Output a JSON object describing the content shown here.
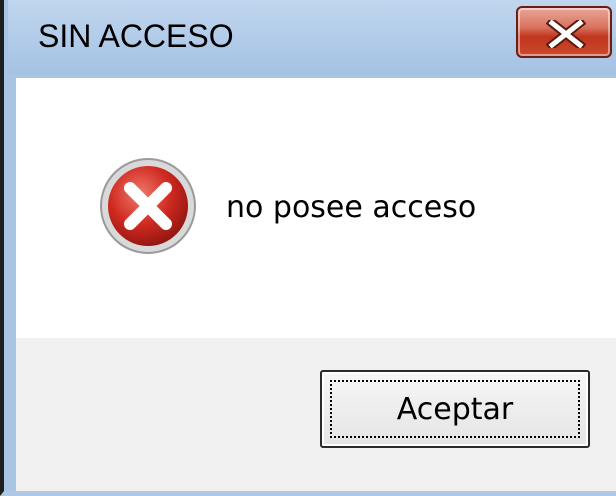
{
  "window": {
    "title": "SIN ACCESO",
    "close_icon": "close-x-icon"
  },
  "message": {
    "icon": "error-icon",
    "text": "no posee acceso"
  },
  "buttons": {
    "ok_label": "Aceptar"
  },
  "colors": {
    "titlebar": "#a9c5e4",
    "close_button": "#c1351d",
    "error_icon": "#c62828",
    "content_bg": "#ffffff",
    "footer_bg": "#f0f0f0"
  }
}
